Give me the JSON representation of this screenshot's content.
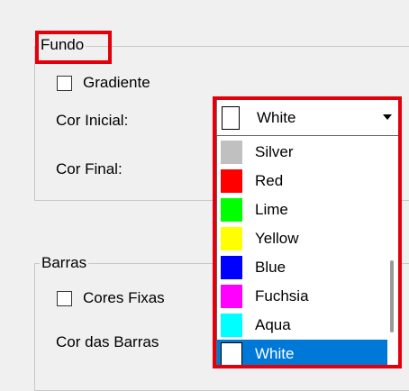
{
  "fundo": {
    "title": "Fundo",
    "gradiente_label": "Gradiente",
    "cor_inicial_label": "Cor Inicial:",
    "cor_final_label": "Cor Final:"
  },
  "barras": {
    "title": "Barras",
    "cores_fixas_label": "Cores Fixas",
    "cor_barras_label": "Cor das Barras"
  },
  "color_combo": {
    "value": "White",
    "swatch_color": "#ffffff"
  },
  "color_options": [
    {
      "name": "Silver",
      "color": "#c0c0c0"
    },
    {
      "name": "Red",
      "color": "#ff0000"
    },
    {
      "name": "Lime",
      "color": "#00ff00"
    },
    {
      "name": "Yellow",
      "color": "#ffff00"
    },
    {
      "name": "Blue",
      "color": "#0000ff"
    },
    {
      "name": "Fuchsia",
      "color": "#ff00ff"
    },
    {
      "name": "Aqua",
      "color": "#00ffff"
    },
    {
      "name": "White",
      "color": "#ffffff",
      "selected": true
    }
  ],
  "colors": {
    "highlight": "#e3000b",
    "selection": "#0078d7"
  }
}
